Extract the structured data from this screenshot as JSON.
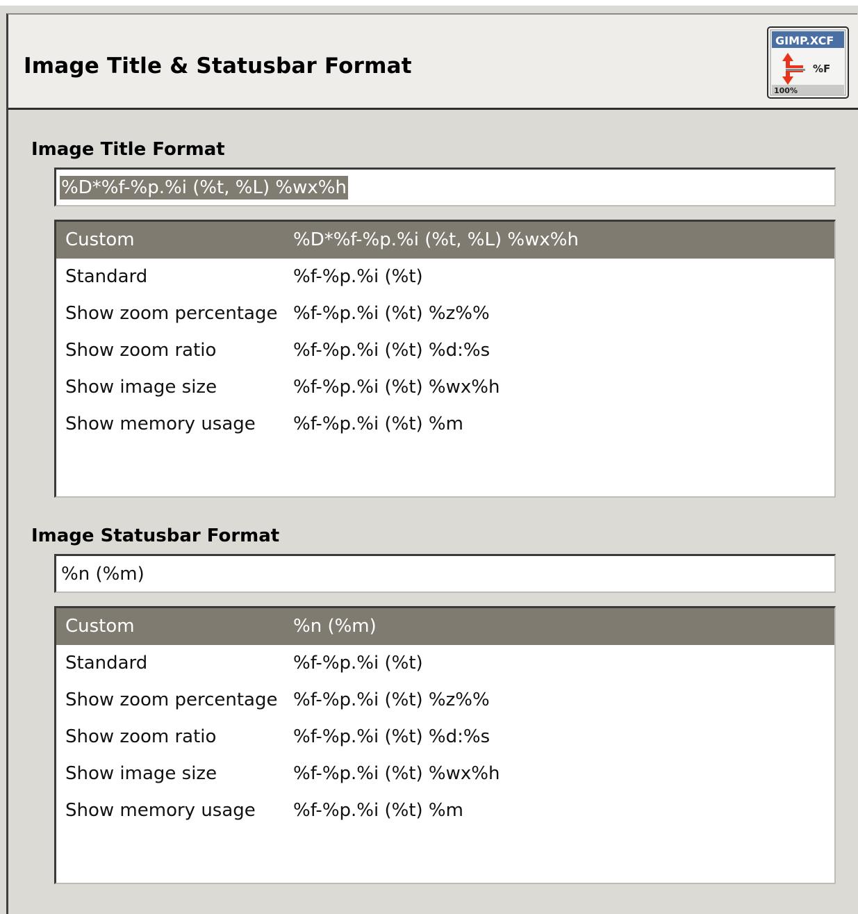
{
  "page": {
    "title": "Image Title & Statusbar Format",
    "icon": {
      "name": "gimp-xcf-format-icon",
      "label_top": "GIMP.XCF",
      "label_right": "%F",
      "label_bottom": "100%"
    }
  },
  "title_format": {
    "label": "Image Title Format",
    "entry_value": "%D*%f-%p.%i (%t, %L) %wx%h",
    "entry_text_selected": true,
    "options": [
      {
        "name": "Custom",
        "format": "%D*%f-%p.%i (%t, %L) %wx%h",
        "selected": true
      },
      {
        "name": "Standard",
        "format": "%f-%p.%i (%t)",
        "selected": false
      },
      {
        "name": "Show zoom percentage",
        "format": "%f-%p.%i (%t) %z%%",
        "selected": false
      },
      {
        "name": "Show zoom ratio",
        "format": "%f-%p.%i (%t) %d:%s",
        "selected": false
      },
      {
        "name": "Show image size",
        "format": "%f-%p.%i (%t) %wx%h",
        "selected": false
      },
      {
        "name": "Show memory usage",
        "format": "%f-%p.%i (%t) %m",
        "selected": false
      }
    ]
  },
  "statusbar_format": {
    "label": "Image Statusbar Format",
    "entry_value": "%n (%m)",
    "entry_text_selected": false,
    "options": [
      {
        "name": "Custom",
        "format": "%n (%m)",
        "selected": true
      },
      {
        "name": "Standard",
        "format": "%f-%p.%i (%t)",
        "selected": false
      },
      {
        "name": "Show zoom percentage",
        "format": "%f-%p.%i (%t) %z%%",
        "selected": false
      },
      {
        "name": "Show zoom ratio",
        "format": "%f-%p.%i (%t) %d:%s",
        "selected": false
      },
      {
        "name": "Show image size",
        "format": "%f-%p.%i (%t) %wx%h",
        "selected": false
      },
      {
        "name": "Show memory usage",
        "format": "%f-%p.%i (%t) %m",
        "selected": false
      }
    ]
  },
  "colors": {
    "background": "#dcdad5",
    "header_background": "#eeedea",
    "selection": "#807b71",
    "selection_text": "#ffffff",
    "icon_arrow": "#e8341c",
    "icon_banner": "#4a6fa5"
  }
}
